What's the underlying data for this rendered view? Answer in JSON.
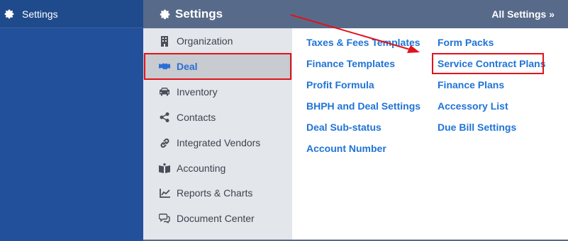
{
  "app_sidebar": {
    "settings_label": "Settings"
  },
  "header": {
    "title": "Settings",
    "all_settings_label": "All Settings »"
  },
  "category_nav": {
    "items": [
      {
        "label": "Organization",
        "icon": "building-icon"
      },
      {
        "label": "Deal",
        "icon": "handshake-icon",
        "active": true
      },
      {
        "label": "Inventory",
        "icon": "car-icon"
      },
      {
        "label": "Contacts",
        "icon": "share-icon"
      },
      {
        "label": "Integrated Vendors",
        "icon": "link-icon"
      },
      {
        "label": "Accounting",
        "icon": "book-icon"
      },
      {
        "label": "Reports & Charts",
        "icon": "line-chart-icon"
      },
      {
        "label": "Document Center",
        "icon": "comments-icon"
      }
    ]
  },
  "deal_links": {
    "column1": [
      "Taxes & Fees Templates",
      "Finance Templates",
      "Profit Formula",
      "BHPH and Deal Settings",
      "Deal Sub-status",
      "Account Number"
    ],
    "column2": [
      "Form Packs",
      "Service Contract Plans",
      "Finance Plans",
      "Accessory List",
      "Due Bill Settings"
    ]
  },
  "colors": {
    "sidebar": "#214c8d",
    "header": "#586a8a",
    "link": "#1f73d6",
    "annotation": "#e0131b",
    "active_text": "#2a6fd6"
  }
}
